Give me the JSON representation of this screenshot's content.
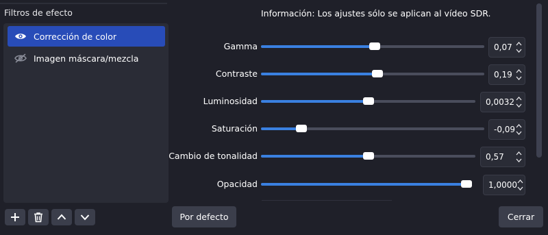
{
  "filters_panel": {
    "title": "Filtros de efecto",
    "items": [
      {
        "label": "Corrección de color",
        "visible": true,
        "selected": true
      },
      {
        "label": "Imagen máscara/mezcla",
        "visible": false,
        "selected": false
      }
    ],
    "buttons": {
      "add_icon": "plus-icon",
      "delete_icon": "trash-icon",
      "move_up_icon": "chevron-up-icon",
      "move_down_icon": "chevron-down-icon"
    }
  },
  "settings": {
    "info": "Información: Los ajustes sólo se aplican al vídeo SDR.",
    "rows": [
      {
        "label": "Gamma",
        "value": "0,07",
        "level": 0.51
      },
      {
        "label": "Contraste",
        "value": "0,19",
        "level": 0.52
      },
      {
        "label": "Luminosidad",
        "value": "0,0032",
        "level": 0.5
      },
      {
        "label": "Saturación",
        "value": "-0,09",
        "level": 0.18
      },
      {
        "label": "Cambio de tonalidad",
        "value": "0,57",
        "level": 0.5
      },
      {
        "label": "Opacidad",
        "value": "1,0000",
        "level": 1.0
      }
    ]
  },
  "footer": {
    "defaults_button": "Por defecto",
    "close_button": "Cerrar"
  },
  "colors": {
    "background": "#1f2029",
    "panel": "#2a2c36",
    "selection": "#284cb8",
    "slider_fill": "#3a80e0",
    "slider_track": "#4a4d5c",
    "button": "#3b3e4b"
  }
}
